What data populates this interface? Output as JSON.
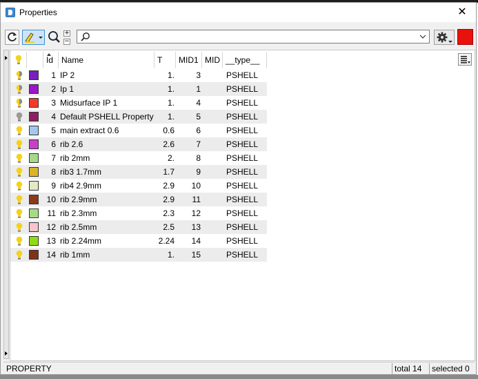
{
  "window": {
    "title": "Properties",
    "close_glyph": "✕"
  },
  "search": {
    "value": "",
    "placeholder": ""
  },
  "columns": {
    "id": "Id",
    "name": "Name",
    "t": "T",
    "mid1": "MID1",
    "mid": "MID",
    "type": "__type__"
  },
  "rows": [
    {
      "id": "1",
      "name": "IP 2",
      "t": "1.",
      "mid1": "3",
      "type": "PSHELL",
      "color": "#7a1ebe",
      "bulb": "partial"
    },
    {
      "id": "2",
      "name": "Ip 1",
      "t": "1.",
      "mid1": "1",
      "type": "PSHELL",
      "color": "#a012cc",
      "bulb": "partial"
    },
    {
      "id": "3",
      "name": "Midsurface IP 1",
      "t": "1.",
      "mid1": "4",
      "type": "PSHELL",
      "color": "#f53a2a",
      "bulb": "partial"
    },
    {
      "id": "4",
      "name": "Default PSHELL Property",
      "t": "1.",
      "mid1": "5",
      "type": "PSHELL",
      "color": "#8e1e64",
      "bulb": "off"
    },
    {
      "id": "5",
      "name": "main extract 0.6",
      "t": "0.6",
      "mid1": "6",
      "type": "PSHELL",
      "color": "#a6c6ec",
      "bulb": "on"
    },
    {
      "id": "6",
      "name": "rib 2.6",
      "t": "2.6",
      "mid1": "7",
      "type": "PSHELL",
      "color": "#c840c8",
      "bulb": "on"
    },
    {
      "id": "7",
      "name": "rib 2mm",
      "t": "2.",
      "mid1": "8",
      "type": "PSHELL",
      "color": "#a8d888",
      "bulb": "on"
    },
    {
      "id": "8",
      "name": "rib3 1.7mm",
      "t": "1.7",
      "mid1": "9",
      "type": "PSHELL",
      "color": "#ddb428",
      "bulb": "on"
    },
    {
      "id": "9",
      "name": "rib4 2.9mm",
      "t": "2.9",
      "mid1": "10",
      "type": "PSHELL",
      "color": "#e4e8c4",
      "bulb": "on"
    },
    {
      "id": "10",
      "name": "rib 2.9mm",
      "t": "2.9",
      "mid1": "11",
      "type": "PSHELL",
      "color": "#8a3a1c",
      "bulb": "on"
    },
    {
      "id": "11",
      "name": "rib 2.3mm",
      "t": "2.3",
      "mid1": "12",
      "type": "PSHELL",
      "color": "#a4dc84",
      "bulb": "on"
    },
    {
      "id": "12",
      "name": "rib 2.5mm",
      "t": "2.5",
      "mid1": "13",
      "type": "PSHELL",
      "color": "#f8c4cc",
      "bulb": "on"
    },
    {
      "id": "13",
      "name": "rib 2.24mm",
      "t": "2.24",
      "mid1": "14",
      "type": "PSHELL",
      "color": "#90dc14",
      "bulb": "on"
    },
    {
      "id": "14",
      "name": "rib 1mm",
      "t": "1.",
      "mid1": "15",
      "type": "PSHELL",
      "color": "#7c3418",
      "bulb": "on"
    }
  ],
  "status": {
    "left": "PROPERTY",
    "total": "total 14",
    "selected": "selected 0"
  },
  "colors": {
    "accent": "#3b8ed8",
    "alt_row": "#ececec",
    "bulb_on": "#f4d21c",
    "bulb_off": "#9a9a9a",
    "red_button": "#e8120c"
  },
  "icons": [
    "app-icon",
    "close-icon",
    "refresh-icon",
    "highlight-icon",
    "zoom-icon",
    "plus-icon",
    "minus-icon",
    "search-icon",
    "chevron-down-icon",
    "gear-icon",
    "red-square-icon",
    "column-chooser-icon",
    "lightbulb-icon"
  ]
}
